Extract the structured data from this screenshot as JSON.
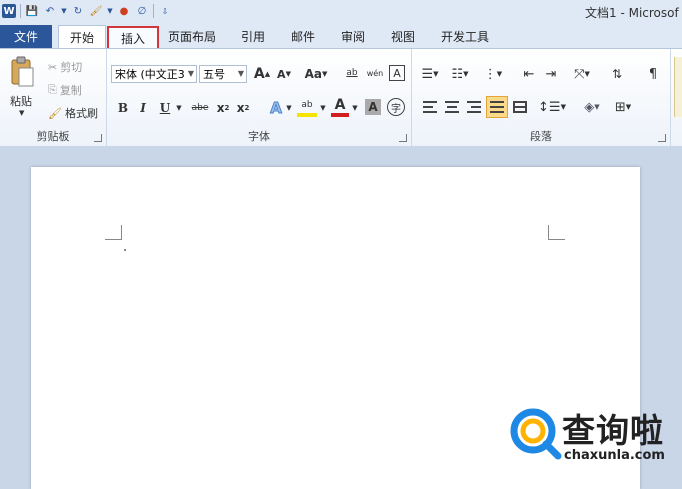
{
  "app": {
    "title": "文档1 - Microsof"
  },
  "tabs": {
    "file": "文件",
    "items": [
      {
        "label": "开始"
      },
      {
        "label": "插入"
      },
      {
        "label": "页面布局"
      },
      {
        "label": "引用"
      },
      {
        "label": "邮件"
      },
      {
        "label": "审阅"
      },
      {
        "label": "视图"
      },
      {
        "label": "开发工具"
      }
    ],
    "active": "开始",
    "highlighted": "插入",
    "highlight_color": "#d2363b"
  },
  "clipboard": {
    "label": "剪贴板",
    "paste": "粘贴",
    "cut": "剪切",
    "copy": "复制",
    "format_painter": "格式刷"
  },
  "font": {
    "label": "字体",
    "family": "宋体 (中文正3",
    "size": "五号",
    "grow": "A",
    "shrink": "A",
    "case": "Aa",
    "bold": "B",
    "italic": "I",
    "underline": "U",
    "strike": "abe",
    "subscript": "x",
    "superscript": "x",
    "clear_format_glyph": "ab",
    "phonetic_glyph": "wén",
    "char_border": "A",
    "effects": "A",
    "highlight": "ab",
    "font_color": "A",
    "char_shading": "A",
    "enclose": "字"
  },
  "paragraph": {
    "label": "段落"
  },
  "watermark": {
    "brand": "查询啦",
    "url": "chaxunla.com",
    "accent": "#1e88e5"
  }
}
